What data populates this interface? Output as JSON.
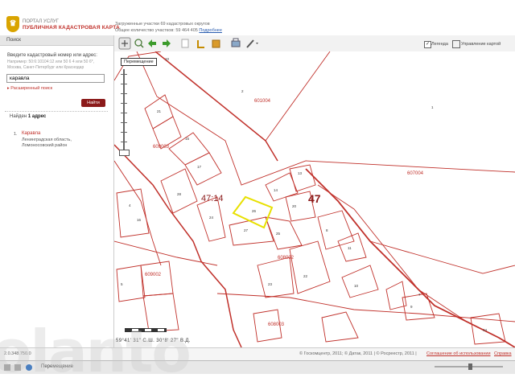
{
  "header": {
    "portal_small": "ПОРТАЛ УСЛУГ",
    "portal_title": "ПУБЛИЧНАЯ КАДАСТРОВАЯ КАРТА",
    "stats_line1": "Загруженные участки 69 кадастровых округов",
    "stats_line2": "Общее количество участков: 59 464 405",
    "stats_link": "Подробнее"
  },
  "sidebar": {
    "title": "Поиск",
    "hint_title": "Введите кадастровый номер или адрес:",
    "hint_example": "Например: 50:6:10104:12 или 50 6 4 или 50 6*, Москва, Санкт-Петербург или Краснодар",
    "search_value": "каравла",
    "advanced_link": "Расширенный поиск",
    "find_button": "Найти",
    "found_prefix": "Найден",
    "found_count": "1 адрес",
    "result_num": "1.",
    "result_name": "Каравла",
    "result_addr": "Ленинградская область, Ломоносовский район"
  },
  "toolbar": {
    "pan_tooltip": "Перемещение",
    "legend_label": "Легенда",
    "layers_label": "Управление картой"
  },
  "map": {
    "parcels": [
      "601004",
      "607004",
      "609003",
      "608002",
      "609002",
      "608003"
    ],
    "quarter_label": "47:14",
    "big_label": "47",
    "lot_labels": [
      "2",
      "1",
      "13",
      "14",
      "20",
      "17",
      "28",
      "24",
      "26",
      "27",
      "25",
      "23",
      "22",
      "11",
      "10",
      "9",
      "7",
      "5",
      "44",
      "10",
      "4",
      "15",
      "21",
      "8",
      "16"
    ],
    "coords": "59°41' 31\" С.Ш.   30°8' 27\" В.Д."
  },
  "footer": {
    "version": "2.0.348.750.0",
    "copyright": "© Госкомцентр, 2011; © Датак, 2011 | © Росреестр, 2011 |",
    "terms": "Соглашение об использовании",
    "help": "Справка"
  },
  "statusbar": {
    "status_text": "Перемещение"
  },
  "colors": {
    "parcel_line": "#c0302a",
    "selected_parcel": "#e8e000",
    "brand_red": "#c0302a",
    "button_dark_red": "#8b1a1a"
  },
  "icons": [
    "pan-icon",
    "zoom-in-icon",
    "back-arrow-icon",
    "forward-arrow-icon",
    "info-icon",
    "measure-icon",
    "print-icon",
    "settings-icon",
    "layers-icon"
  ]
}
